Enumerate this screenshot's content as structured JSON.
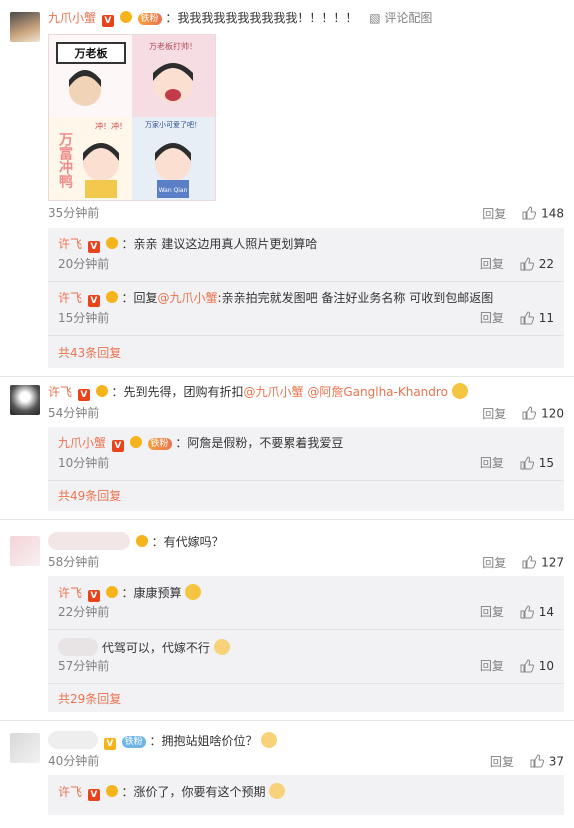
{
  "comments": [
    {
      "user": "九爪小蟹",
      "fan_badge": "铁粉",
      "text": "：我我我我我我我我我我！！！！！",
      "action": "评论配图",
      "image_texts": [
        "万老板",
        "万老板打帅！",
        "万富冲鸭",
        "冲！冲！",
        "万家小可爱了吧！",
        "Wan Qian"
      ],
      "time": "35分钟前",
      "reply": "回复",
      "likes": "148",
      "replies": [
        {
          "user": "许飞",
          "text": "：亲亲 建议这边用真人照片更划算哈",
          "time": "20分钟前",
          "reply": "回复",
          "likes": "22"
        },
        {
          "user": "许飞",
          "prefix": "：回复",
          "mention": "@九爪小蟹",
          "text": ":亲亲拍完就发图吧 备注好业务名称 可收到包邮返图",
          "time": "15分钟前",
          "reply": "回复",
          "likes": "11"
        }
      ],
      "more": "共43条回复"
    },
    {
      "user": "许飞",
      "text1": "：先到先得，团购有折扣",
      "mention1": "@九爪小蟹",
      "mention2": "@阿詹Ganglha-Khandro",
      "time": "54分钟前",
      "reply": "回复",
      "likes": "120",
      "replies": [
        {
          "user": "九爪小蟹",
          "fan_badge": "铁粉",
          "text": "：阿詹是假粉，不要累着我爱豆",
          "time": "10分钟前",
          "reply": "回复",
          "likes": "15"
        }
      ],
      "more": "共49条回复"
    },
    {
      "text": "：有代嫁吗？",
      "time": "58分钟前",
      "reply": "回复",
      "likes": "127",
      "replies": [
        {
          "user": "许飞",
          "text": "：康康预算",
          "time": "22分钟前",
          "reply": "回复",
          "likes": "14"
        },
        {
          "text": "代驾可以，代嫁不行",
          "time": "57分钟前",
          "reply": "回复",
          "likes": "10"
        }
      ],
      "more": "共29条回复"
    },
    {
      "fan_badge": "铁粉",
      "text": "：拥抱站姐啥价位？",
      "time": "40分钟前",
      "reply": "回复",
      "likes": "37",
      "replies": [
        {
          "user": "许飞",
          "text": "：涨价了，你要有这个预期"
        }
      ]
    }
  ],
  "colors": {
    "accent": "#eb7350",
    "reply_bg": "#f2f2f5",
    "vip": "#e8431b"
  }
}
